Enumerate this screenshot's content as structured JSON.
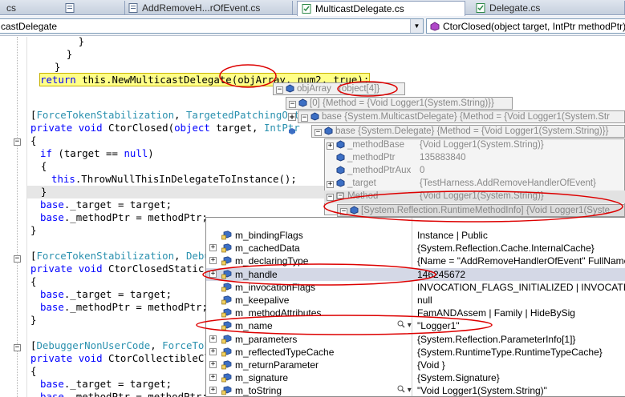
{
  "tabs": [
    {
      "label": "cs",
      "active": false
    },
    {
      "label": "AddRemoveH...rOfEvent.cs",
      "active": false
    },
    {
      "label": "MulticastDelegate.cs",
      "active": true
    },
    {
      "label": "Delegate.cs",
      "active": false
    }
  ],
  "nav": {
    "type_combo": "castDelegate",
    "member_combo": "CtorClosed(object target, IntPtr methodPtr)"
  },
  "code": {
    "l1": "        }",
    "l2": "      }",
    "l3": "    }",
    "l4_kw": "return",
    "l4_mid": " this.NewMulticastDelegate(",
    "l4_var": "objArray",
    "l4_end": ", num2, true);",
    "l5_a": "[",
    "l5_t1": "ForceTokenStabilization",
    "l5_b": ", ",
    "l5_t2": "TargetedPatchingOptO",
    "l6_k1": "private",
    "l6_k2": "void",
    "l6_rest": " CtorClosed(",
    "l6_k3": "object",
    "l6_rest2": " target, ",
    "l6_t": "IntPtr",
    "l7": "{",
    "l8_k": "if",
    "l8_rest": " (target == ",
    "l8_k2": "null",
    "l8_end": ")",
    "l9": "  {",
    "l10_k": "this",
    "l10_rest": ".ThrowNullThisInDelegateToInstance();",
    "l11": "  }",
    "l12_k": "base",
    "l12_rest": "._target = target;",
    "l13_k": "base",
    "l13_rest": "._methodPtr = methodPtr;",
    "l14": "}",
    "l15_a": "[",
    "l15_t1": "ForceTokenStabilization",
    "l15_b": ", ",
    "l15_t2": "Debug",
    "l16_k1": "private",
    "l16_k2": "void",
    "l16_rest": " CtorClosedStatic(",
    "l16_tail": "o",
    "l17": "{",
    "l18_k": "base",
    "l18_rest": "._target = target;",
    "l19_k": "base",
    "l19_rest": "._methodPtr = methodPtr;",
    "l20": "}",
    "l21_a": "[",
    "l21_t1": "DebuggerNonUserCode",
    "l21_b": ", ",
    "l21_t2": "ForceToke",
    "l22_k1": "private",
    "l22_k2": "void",
    "l22_rest": " CtorCollectibleClo",
    "l23": "{",
    "l24_k": "base",
    "l24_rest": "._target = target;",
    "l25_k": "base",
    "l25_rest": "._methodPtr = methodPtr;"
  },
  "datatips": [
    {
      "name": "objArray",
      "value": "{object[4]}",
      "expander": "−"
    },
    {
      "name": "[0]",
      "value": "{Method = {Void Logger1(System.String)}}",
      "expander": "−"
    },
    {
      "name": "base",
      "value": "{System.MulticastDelegate}  {Method = {Void Logger1(System.Str",
      "expander": "−"
    },
    {
      "name": "base",
      "value": "{System.Delegate}  {Method = {Void Logger1(System.String)}}",
      "expander": "−"
    },
    {
      "name": "_methodBase",
      "value": "{Void Logger1(System.String)}",
      "expander": "+"
    },
    {
      "name": "_methodPtr",
      "value": "135883840",
      "expander": ""
    },
    {
      "name": "_methodPtrAux",
      "value": "0",
      "expander": ""
    },
    {
      "name": "_target",
      "value": "{TestHarness.AddRemoveHandlerOfEvent}",
      "expander": "+"
    },
    {
      "name": "Method",
      "value": "{Void Logger1(System.String)}",
      "expander": "−"
    },
    {
      "name": "[System.Reflection.RuntimeMethodInfo]",
      "value": "{Void Logger1(Syste",
      "expander": "−"
    }
  ],
  "watch_rows": [
    {
      "name": "m_bindingFlags",
      "value": "Instance | Public",
      "expander": ""
    },
    {
      "name": "m_cachedData",
      "value": "{System.Reflection.Cache.InternalCache}",
      "expander": "+"
    },
    {
      "name": "m_declaringType",
      "value": "{Name = \"AddRemoveHandlerOfEvent\" FullName",
      "expander": "+"
    },
    {
      "name": "m_handle",
      "value": "146245672",
      "expander": "+"
    },
    {
      "name": "m_invocationFlags",
      "value": "INVOCATION_FLAGS_INITIALIZED | INVOCATION",
      "expander": ""
    },
    {
      "name": "m_keepalive",
      "value": "null",
      "expander": ""
    },
    {
      "name": "m_methodAttributes",
      "value": "FamANDAssem | Family | HideBySig",
      "expander": ""
    },
    {
      "name": "m_name",
      "value": "\"Logger1\"",
      "expander": ""
    },
    {
      "name": "m_parameters",
      "value": "{System.Reflection.ParameterInfo[1]}",
      "expander": "+"
    },
    {
      "name": "m_reflectedTypeCache",
      "value": "{System.RuntimeType.RuntimeTypeCache}",
      "expander": "+"
    },
    {
      "name": "m_returnParameter",
      "value": "{Void }",
      "expander": "+"
    },
    {
      "name": "m_signature",
      "value": "{System.Signature}",
      "expander": "+"
    },
    {
      "name": "m_toString",
      "value": "\"Void Logger1(System.String)\"",
      "expander": "+"
    }
  ],
  "colors": {
    "keyword": "#0000ff",
    "type": "#2b91af",
    "highlight": "#ffff88",
    "annotation": "#dd0000",
    "field_icon": "#3c6fc4"
  },
  "icons": {
    "field": "field-icon",
    "magnifier": "magnifier-icon",
    "dropdown": "dropdown-arrow-icon"
  }
}
